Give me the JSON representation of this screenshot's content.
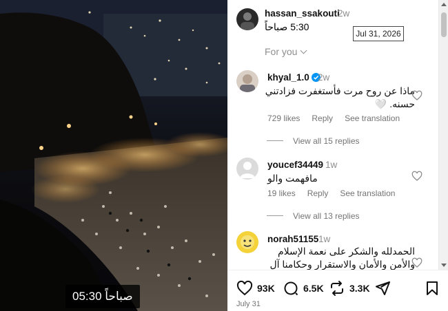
{
  "video": {
    "timestamp_overlay": "05:30 صباحاً"
  },
  "post": {
    "author": "hassan_ssakouti",
    "age": "2w",
    "caption": "5:30 صباحاً",
    "date_tooltip": "Jul 31, 2026",
    "feed_label": "For you"
  },
  "comments": [
    {
      "username": "khyal_1.0",
      "verified": true,
      "age": "2w",
      "text_line1": "ماذا عن روح مرت فأستغفرت فزادتني",
      "text_line2": "حسنه. 🤍",
      "likes": "729 likes",
      "reply": "Reply",
      "translate": "See translation",
      "view_replies": "View all 15 replies"
    },
    {
      "username": "youcef34449",
      "verified": false,
      "age": "1w",
      "text_line1": "مافهمت والو",
      "likes": "19 likes",
      "reply": "Reply",
      "translate": "See translation",
      "view_replies": "View all 13 replies"
    },
    {
      "username": "norah51155",
      "verified": false,
      "age": "1w",
      "text_line1": "الحمدلله والشكر على نعمة الإسلام",
      "text_line2": "والأمن والأمان والاستقرار وحكامنا آل"
    }
  ],
  "actions": {
    "like_count": "93K",
    "comment_count": "6.5K",
    "repost_count": "3.3K",
    "post_date": "July 31"
  }
}
